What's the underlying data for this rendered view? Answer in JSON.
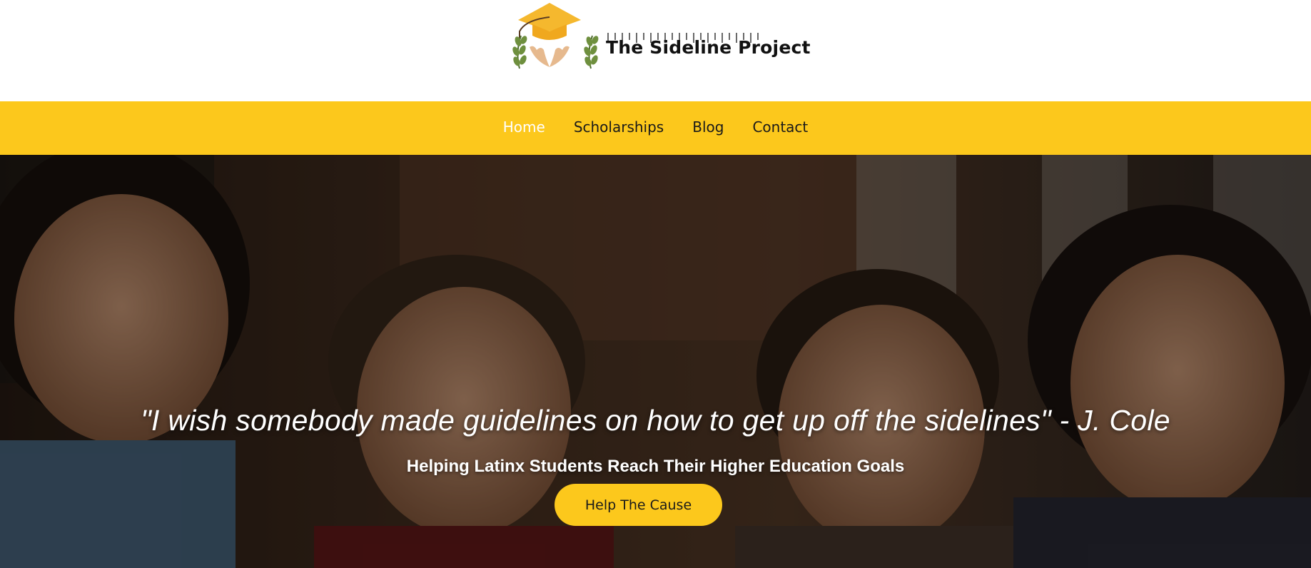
{
  "site": {
    "logo_text": "The Sideline Project",
    "brand_color": "#fcc81c"
  },
  "nav": {
    "items": [
      {
        "label": "Home",
        "active": true
      },
      {
        "label": "Scholarships",
        "active": false
      },
      {
        "label": "Blog",
        "active": false
      },
      {
        "label": "Contact",
        "active": false
      }
    ]
  },
  "hero": {
    "quote": "\"I wish somebody made guidelines on how to get up off the sidelines\" - J. Cole",
    "subtitle": "Helping Latinx Students Reach Their Higher Education Goals",
    "cta_label": "Help The Cause"
  },
  "icons": [
    "graduation-cap-icon",
    "laurel-branch-icon",
    "hands-icon"
  ]
}
